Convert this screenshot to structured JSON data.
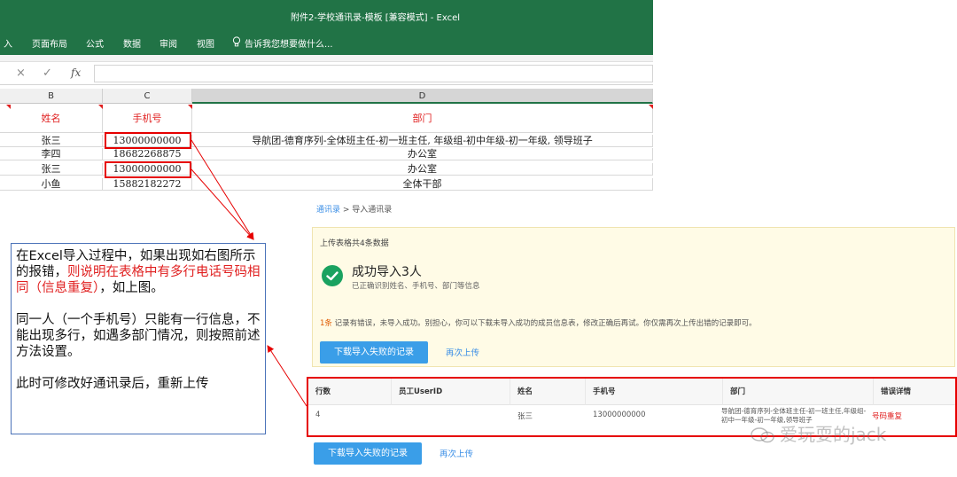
{
  "excel": {
    "window_title": "附件2-学校通讯录-模板 [兼容模式] - Excel",
    "ribbon_tabs": [
      "入",
      "页面布局",
      "公式",
      "数据",
      "审阅",
      "视图"
    ],
    "tell_me": "告诉我您想要做什么...",
    "formula_icons": {
      "cancel": "×",
      "confirm": "✓",
      "fx": "fx"
    },
    "columns": [
      "B",
      "C",
      "D"
    ],
    "headers": {
      "name": "姓名",
      "phone": "手机号",
      "dept": "部门"
    },
    "rows": [
      {
        "name": "张三",
        "phone": "13000000000",
        "dept": "导航团-德育序列-全体班主任-初一班主任, 年级组-初中年级-初一年级, 领导班子"
      },
      {
        "name": "李四",
        "phone": "18682268875",
        "dept": "办公室"
      },
      {
        "name": "张三",
        "phone": "13000000000",
        "dept": "办公室"
      },
      {
        "name": "小鱼",
        "phone": "15882182272",
        "dept": "全体干部"
      }
    ]
  },
  "callout": {
    "p1_a": "在Excel导入过程中，如果出现如右图所示的报错，",
    "p1_red": "则说明在表格中有多行电话号码相同（信息重复）",
    "p1_b": "，如上图。",
    "p2": "同一人（一个手机号）只能有一行信息，不能出现多行，如遇多部门情况，则按照前述方法设置。",
    "p3": "此时可修改好通讯录后，重新上传"
  },
  "web": {
    "breadcrumb_link": "通讯录",
    "breadcrumb_sep": " > ",
    "breadcrumb_current": "导入通讯录",
    "upload_meta": "上传表格共4条数据",
    "success_title": "成功导入3人",
    "success_sub": "已正确识别姓名、手机号、部门等信息",
    "error_count": "1条",
    "error_text": " 记录有错误，未导入成功。别担心，你可以下载未导入成功的成员信息表，修改正确后再试。你仅需再次上传出错的记录即可。",
    "download_button": "下载导入失败的记录",
    "reupload_link": "再次上传",
    "table_headers": [
      "行数",
      "员工UserID",
      "姓名",
      "手机号",
      "部门",
      "错误详情"
    ],
    "table_row": {
      "row": "4",
      "userid": "",
      "name": "张三",
      "phone": "13000000000",
      "dept": "导航团-德育序列-全体班主任-初一班主任,年级组-初中一年级-初一年级,领导班子",
      "error": "号码重复"
    },
    "bottom_download_button": "下载导入失败的记录",
    "bottom_reupload_link": "再次上传"
  },
  "watermark": "爱玩耍的jack",
  "colors": {
    "excel_green": "#217346",
    "highlight_red": "#e60000",
    "accent_blue": "#3a9ee8",
    "success_green": "#1aa260",
    "panel_yellow": "#fffbe6"
  }
}
